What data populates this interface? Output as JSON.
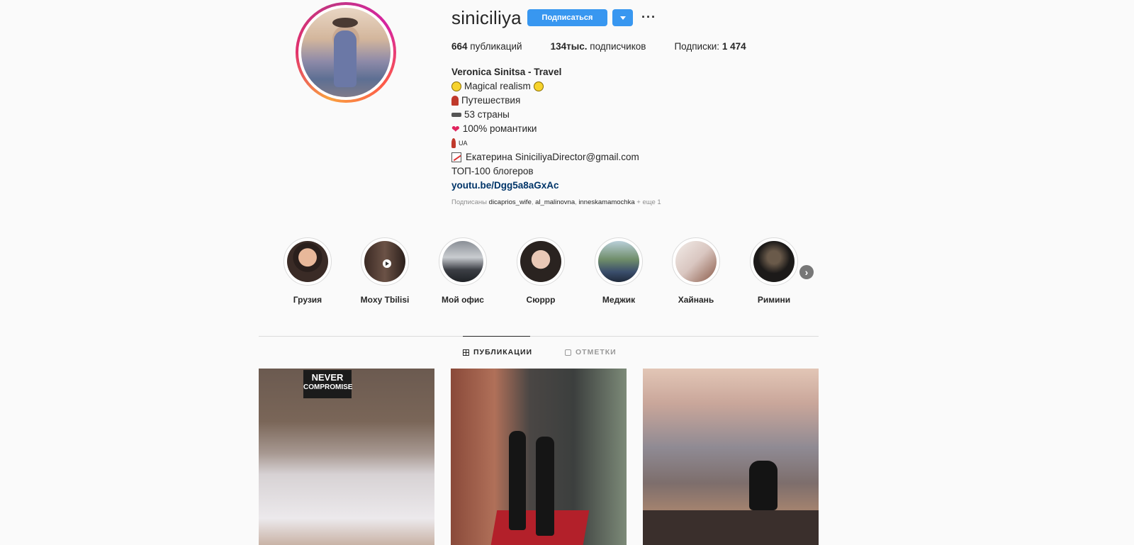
{
  "profile": {
    "username": "siniciliya",
    "follow_label": "Подписаться",
    "more_label": "···",
    "stats": {
      "posts_count": "664",
      "posts_label": "публикаций",
      "followers_count": "134тыс.",
      "followers_label": "подписчиков",
      "following_label": "Подписки:",
      "following_count": "1 474"
    }
  },
  "bio": {
    "name": "Veronica Sinitsa - Travel",
    "line1": "Magical realism",
    "line2": "Путешествия",
    "line3": "53 страны",
    "line4": "100% романтики",
    "line5": "UA",
    "line6": "Екатерина SiniciliyaDirector@gmail.com",
    "line7": "ТОП-100 блогеров",
    "link": "youtu.be/Dgg5a8aGxAc"
  },
  "followed_by": {
    "prefix": "Подписаны",
    "user1": "dicaprios_wife",
    "user2": "al_malinovna",
    "user3": "inneskamamochka",
    "more": "+ еще 1"
  },
  "highlights": [
    {
      "label": "Грузия"
    },
    {
      "label": "Moxy Tbilisi"
    },
    {
      "label": "Мой офис"
    },
    {
      "label": "Сюррр"
    },
    {
      "label": "Меджик"
    },
    {
      "label": "Хайнань"
    },
    {
      "label": "Римини"
    }
  ],
  "tabs": {
    "posts": "ПУБЛИКАЦИИ",
    "tagged": "ОТМЕТКИ"
  },
  "posts": {
    "sign_line1": "NEVER",
    "sign_line2": "COMPROMISE"
  },
  "colors": {
    "accent": "#3897f0",
    "link": "#003569",
    "muted": "#8e8e8e"
  }
}
